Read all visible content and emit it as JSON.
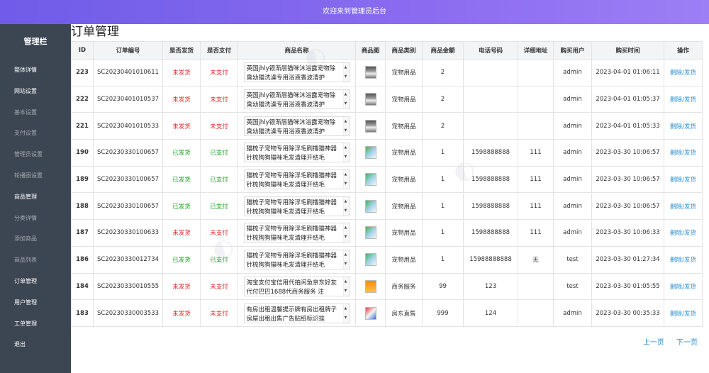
{
  "header": {
    "title": "欢迎来到管理员后台"
  },
  "sidebar": {
    "title": "管理栏",
    "items": [
      {
        "label": "整体详情",
        "active": true
      },
      {
        "label": "网站设置",
        "active": true
      },
      {
        "label": "基本设置",
        "active": false
      },
      {
        "label": "支付设置",
        "active": false
      },
      {
        "label": "管理员设置",
        "active": false
      },
      {
        "label": "轮播图设置",
        "active": false
      },
      {
        "label": "商品管理",
        "active": true
      },
      {
        "label": "分类详情",
        "active": false
      },
      {
        "label": "添加商品",
        "active": false
      },
      {
        "label": "商品列表",
        "active": false
      },
      {
        "label": "订单管理",
        "active": true
      },
      {
        "label": "用户管理",
        "active": true
      },
      {
        "label": "工单管理",
        "active": true
      },
      {
        "label": "退出",
        "active": true
      }
    ]
  },
  "main": {
    "title": "订单管理",
    "columns": [
      "ID",
      "订单编号",
      "是否发货",
      "是否支付",
      "商品名称",
      "商品图",
      "商品类别",
      "商品金额",
      "电话号码",
      "详细地址",
      "购买用户",
      "购买时间",
      "操作"
    ],
    "rows": [
      {
        "id": "223",
        "order_no": "SC20230401010611",
        "shipped": "未发货",
        "shipped_ok": false,
        "paid": "未支付",
        "paid_ok": false,
        "name": "英国jhly银渐层猫咪沐浴露宠物除臭幼猫洗澡专用浴液香波清护",
        "img": "pet",
        "category": "宠物用品",
        "amount": "2",
        "phone": "",
        "address": "",
        "user": "admin",
        "time": "2023-04-01 01:06:11"
      },
      {
        "id": "222",
        "order_no": "SC20230401010537",
        "shipped": "未发货",
        "shipped_ok": false,
        "paid": "未支付",
        "paid_ok": false,
        "name": "英国jhly银渐层猫咪沐浴露宠物除臭幼猫洗澡专用浴液香波清护",
        "img": "pet",
        "category": "宠物用品",
        "amount": "2",
        "phone": "",
        "address": "",
        "user": "admin",
        "time": "2023-04-01 01:05:37"
      },
      {
        "id": "221",
        "order_no": "SC20230401010533",
        "shipped": "未发货",
        "shipped_ok": false,
        "paid": "未支付",
        "paid_ok": false,
        "name": "英国jhly银渐层猫咪沐浴露宠物除臭幼猫洗澡专用浴液香波清护",
        "img": "pet",
        "category": "宠物用品",
        "amount": "2",
        "phone": "",
        "address": "",
        "user": "admin",
        "time": "2023-04-01 01:05:33"
      },
      {
        "id": "190",
        "order_no": "SC20230330100657",
        "shipped": "已发货",
        "shipped_ok": true,
        "paid": "已支付",
        "paid_ok": true,
        "name": "猫梳子宠物专用除浮毛刷撸猫神器针梳狗狗猫咪毛发清理开结毛",
        "img": "comb",
        "category": "宠物用品",
        "amount": "1",
        "phone": "1598888888",
        "address": "111",
        "user": "admin",
        "time": "2023-03-30 10:06:57"
      },
      {
        "id": "189",
        "order_no": "SC20230330100657",
        "shipped": "已发货",
        "shipped_ok": true,
        "paid": "已支付",
        "paid_ok": true,
        "name": "猫梳子宠物专用除浮毛刷撸猫神器针梳狗狗猫咪毛发清理开结毛",
        "img": "comb",
        "category": "宠物用品",
        "amount": "1",
        "phone": "1598888888",
        "address": "111",
        "user": "admin",
        "time": "2023-03-30 10:06:57"
      },
      {
        "id": "188",
        "order_no": "SC20230330100657",
        "shipped": "已发货",
        "shipped_ok": true,
        "paid": "已支付",
        "paid_ok": true,
        "name": "猫梳子宠物专用除浮毛刷撸猫神器针梳狗狗猫咪毛发清理开结毛",
        "img": "comb",
        "category": "宠物用品",
        "amount": "1",
        "phone": "1598888888",
        "address": "111",
        "user": "admin",
        "time": "2023-03-30 10:06:57"
      },
      {
        "id": "187",
        "order_no": "SC20230330100633",
        "shipped": "未发货",
        "shipped_ok": false,
        "paid": "未支付",
        "paid_ok": false,
        "name": "猫梳子宠物专用除浮毛刷撸猫神器针梳狗狗猫咪毛发清理开结毛",
        "img": "comb",
        "category": "宠物用品",
        "amount": "1",
        "phone": "1598888888",
        "address": "111",
        "user": "admin",
        "time": "2023-03-30 10:06:33"
      },
      {
        "id": "186",
        "order_no": "SC20230330012734",
        "shipped": "已发货",
        "shipped_ok": true,
        "paid": "已支付",
        "paid_ok": true,
        "name": "猫梳子宠物专用除浮毛刷撸猫神器针梳狗狗猫咪毛发清理开结毛",
        "img": "comb",
        "category": "宠物用品",
        "amount": "1",
        "phone": "15988888888",
        "address": "无",
        "user": "test",
        "time": "2023-03-30 01:27:34"
      },
      {
        "id": "184",
        "order_no": "SC20230330010555",
        "shipped": "未发货",
        "shipped_ok": false,
        "paid": "未支付",
        "paid_ok": false,
        "name": "淘宝支付宝信用代拍闲鱼京东好友代付巴巴1688代商务服务 注",
        "img": "biz",
        "category": "商务服务",
        "amount": "99",
        "phone": "123",
        "address": "",
        "user": "test",
        "time": "2023-03-30 01:05:55"
      },
      {
        "id": "183",
        "order_no": "SC20230330003533",
        "shipped": "未发货",
        "shipped_ok": false,
        "paid": "未支付",
        "paid_ok": false,
        "name": "有房出租温馨提示牌有房出租牌子房屋出租出售广告贴纸标识挂",
        "img": "house",
        "category": "房东直售",
        "amount": "999",
        "phone": "124",
        "address": "",
        "user": "admin",
        "time": "2023-03-30 00:35:33"
      }
    ],
    "actions": {
      "delete": "删除",
      "sep": "/",
      "ship": "发货"
    },
    "pager": {
      "prev": "上一页",
      "next": "下一页"
    }
  },
  "colors": {
    "header_start": "#6f5ce8",
    "header_end": "#9c7ff5",
    "sidebar_bg": "#3c4652",
    "red": "#e02424",
    "green": "#18a018",
    "link": "#2a8fd6"
  },
  "icons": {
    "product_thumb": "product-thumbnail-icon"
  }
}
